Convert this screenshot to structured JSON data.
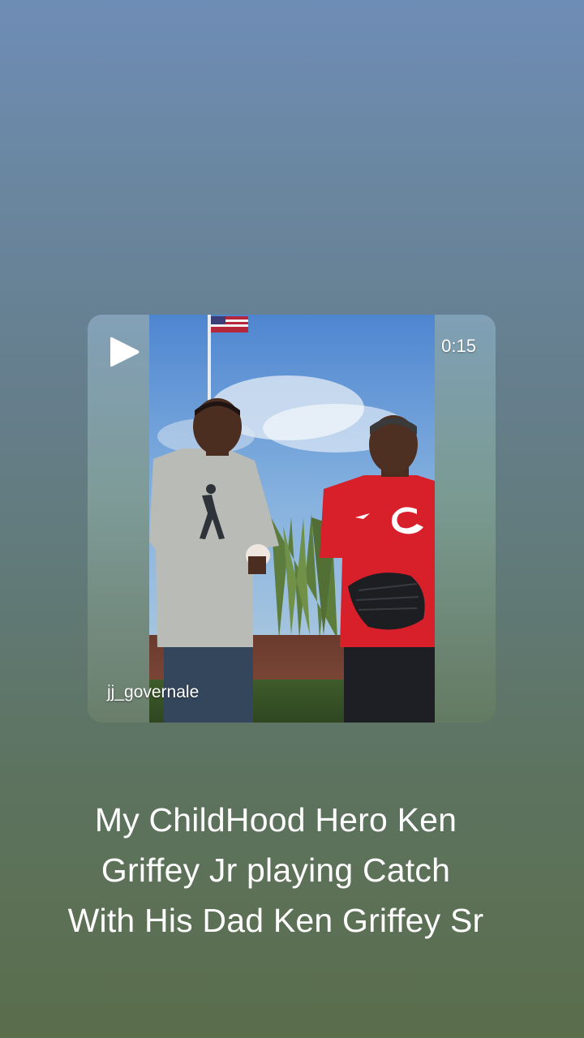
{
  "story": {
    "duration": "0:15",
    "username": "jj_governale",
    "play_icon": "play-icon"
  },
  "caption": {
    "line1": "My ChildHood Hero Ken",
    "line2": "Griffey Jr playing Catch",
    "line3": "With His Dad Ken Griffey Sr"
  },
  "colors": {
    "jersey_red": "#d8202b",
    "sky_blue": "#5f93d8"
  }
}
